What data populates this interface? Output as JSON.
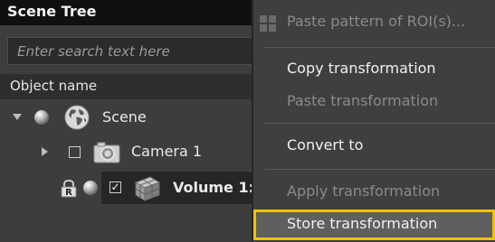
{
  "scene_tree": {
    "title": "Scene Tree",
    "search": {
      "placeholder": "Enter search text here",
      "value": ""
    },
    "columns": {
      "object_name": "Object name"
    },
    "nodes": [
      {
        "label": "Scene",
        "expanded": true,
        "icon": "globe-icon"
      },
      {
        "label": "Camera 1",
        "expanded": false,
        "checked": false,
        "icon": "camera-icon"
      },
      {
        "label": "Volume 1:",
        "checked": true,
        "selected": true,
        "locked": true,
        "icon": "volume-cube-icon"
      }
    ]
  },
  "context_menu": {
    "items": [
      {
        "label": "Paste pattern of ROI(s)...",
        "enabled": false,
        "icon": "pattern-grid-icon"
      },
      {
        "label": "Copy transformation",
        "enabled": true
      },
      {
        "label": "Paste transformation",
        "enabled": false
      },
      {
        "label": "Convert to",
        "enabled": true
      },
      {
        "label": "Apply transformation",
        "enabled": false
      },
      {
        "label": "Store transformation",
        "enabled": true,
        "highlighted": true
      }
    ],
    "highlight_color": "#f4c000"
  }
}
